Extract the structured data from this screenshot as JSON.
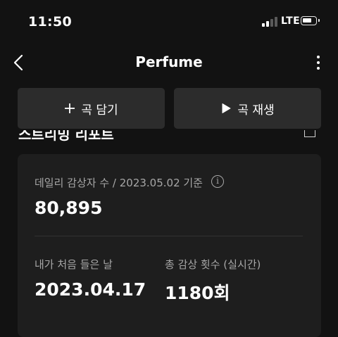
{
  "status_bar": {
    "time": "11:50",
    "network": "LTE",
    "signal_bars": 4,
    "signal_active": 2
  },
  "nav": {
    "title": "Perfume",
    "back_icon": "chevron-left-icon",
    "more_icon": "more-vertical-icon"
  },
  "actions": {
    "add_label": "곡 담기",
    "add_icon": "plus-icon",
    "play_label": "곡 재생",
    "play_icon": "play-icon"
  },
  "section": {
    "partial_title": "스트리밍 리포트",
    "corner_icon": "square-icon"
  },
  "stats": {
    "daily_label": "데일리 감상자 수 / 2023.05.02 기준",
    "daily_value": "80,895",
    "first_label": "내가 처음 들은 날",
    "first_value": "2023.04.17",
    "total_label": "총 감상 횟수 (실시간)",
    "total_value": "1180회",
    "info_icon": "info-icon"
  },
  "colors": {
    "background": "#121212",
    "button": "#2c2c2c",
    "card": "#1e1e1e",
    "muted_text": "#a7a7a7"
  }
}
